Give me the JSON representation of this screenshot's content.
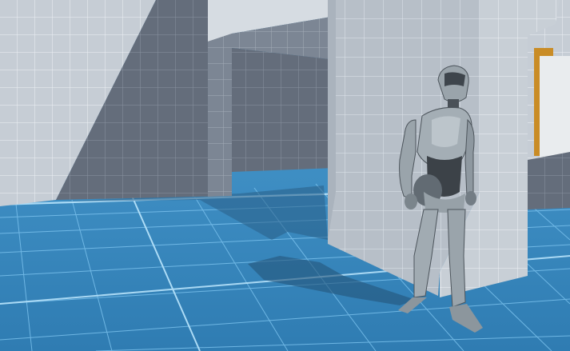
{
  "scene": {
    "type": "3d-game-viewport",
    "environment": "prototype-grid-level",
    "character": "humanoid-robot",
    "colors": {
      "floor": "#3a8bc2",
      "floor_grid": "#7cc2ee",
      "wall_light": "#c4cbd3",
      "wall_shadow": "#5f6977",
      "wall_grid": "#e9eef3",
      "accent_opening": "#d89a2a",
      "robot_body": "#9aa6ad",
      "robot_dark": "#3c4248"
    }
  }
}
